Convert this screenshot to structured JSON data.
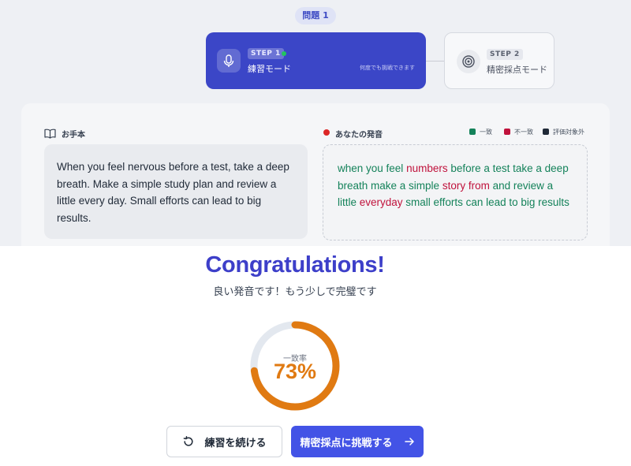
{
  "problem_badge": "問題 1",
  "steps": [
    {
      "tag": "STEP 1",
      "title": "練習モード",
      "hint": "何度でも挑戦できます",
      "icon": "mic-icon",
      "active": true
    },
    {
      "tag": "STEP 2",
      "title": "精密採点モード",
      "icon": "target-icon",
      "active": false
    }
  ],
  "model_section": {
    "label": "お手本",
    "icon": "book-icon",
    "text": "When you feel nervous before a test, take a deep breath. Make a simple study plan and review a little every day. Small efforts can lead to big results."
  },
  "speech_section": {
    "label": "あなたの発音",
    "icon": "record-dot-icon",
    "legend": [
      {
        "label": "一致",
        "color": "#14825a"
      },
      {
        "label": "不一致",
        "color": "#c0123c"
      },
      {
        "label": "評価対象外",
        "color": "#1f2937"
      }
    ],
    "segments": [
      {
        "text": "when you feel ",
        "status": "match"
      },
      {
        "text": "numbers",
        "status": "mismatch"
      },
      {
        "text": " before a test take a deep breath make a simple ",
        "status": "match"
      },
      {
        "text": "story from",
        "status": "mismatch"
      },
      {
        "text": " and review a little ",
        "status": "match"
      },
      {
        "text": "everyday",
        "status": "mismatch"
      },
      {
        "text": " small efforts can lead to big results",
        "status": "match"
      }
    ]
  },
  "result": {
    "title": "Congratulations!",
    "subtitle": "良い発音です！もう少しで完璧です",
    "rate_label": "一致率",
    "rate_value": "73%",
    "rate_fraction": 0.73
  },
  "buttons": {
    "continue_label": "練習を続ける",
    "continue_icon": "refresh-icon",
    "challenge_label": "精密採点に挑戦する",
    "challenge_icon": "arrow-right-icon"
  },
  "colors": {
    "primary": "#3b46c7",
    "accent_orange": "#e07a12",
    "title": "#3d3fc9"
  }
}
